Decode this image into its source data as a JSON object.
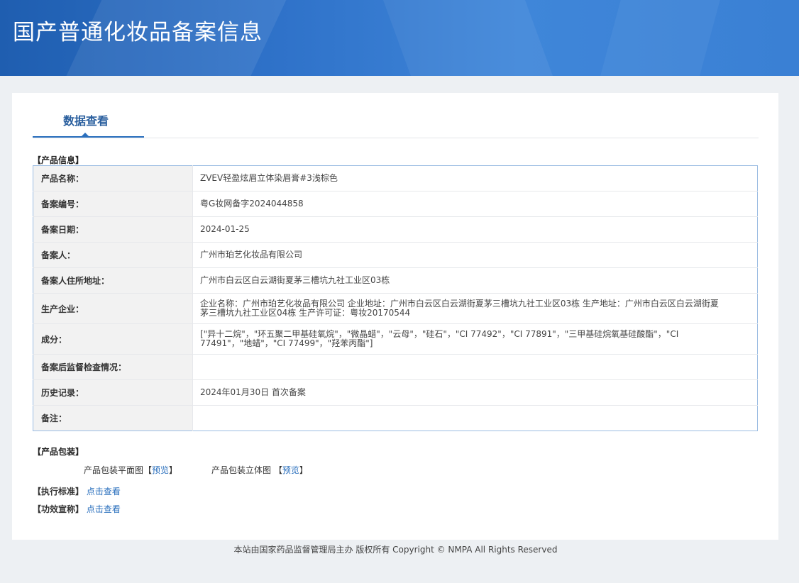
{
  "header": {
    "title": "国产普通化妆品备案信息"
  },
  "tabs": [
    {
      "label": "数据查看"
    }
  ],
  "product_info": {
    "section_title": "【产品信息】",
    "rows": [
      {
        "label": "产品名称：",
        "value": "ZVEV轻盈炫眉立体染眉膏#3浅棕色"
      },
      {
        "label": "备案编号：",
        "value": "粤G妆网备字2024044858"
      },
      {
        "label": "备案日期：",
        "value": "2024-01-25"
      },
      {
        "label": "备案人：",
        "value": "广州市珀艺化妆品有限公司"
      },
      {
        "label": "备案人住所地址：",
        "value": "广州市白云区白云湖街夏茅三槽坑九社工业区03栋"
      },
      {
        "label": "生产企业：",
        "value": "企业名称：广州市珀艺化妆品有限公司 企业地址：广州市白云区白云湖街夏茅三槽坑九社工业区03栋 生产地址：广州市白云区白云湖街夏茅三槽坑九社工业区04栋 生产许可证：粤妆20170544"
      },
      {
        "label": "成分：",
        "value": "[\"异十二烷\"，\"环五聚二甲基硅氧烷\"，\"微晶蜡\"，\"云母\"，\"硅石\"，\"CI 77492\"，\"CI 77891\"，\"三甲基硅烷氧基硅酸酯\"，\"CI 77491\"，\"地蜡\"，\"CI 77499\"，\"羟苯丙酯\"]"
      },
      {
        "label": "备案后监督检查情况：",
        "value": ""
      },
      {
        "label": "历史记录：",
        "value": "2024年01月30日 首次备案"
      },
      {
        "label": "备注：",
        "value": ""
      }
    ]
  },
  "packaging": {
    "section_title": "【产品包装】",
    "flat_label": "产品包装平面图",
    "solid_label": "产品包装立体图",
    "bracket_open": "【",
    "bracket_close": "】",
    "preview_link": "预览"
  },
  "standard": {
    "label": "【执行标准】",
    "link": "点击查看"
  },
  "efficacy": {
    "label": "【功效宣称】",
    "link": "点击查看"
  },
  "footer": {
    "text": "本站由国家药品监督管理局主办 版权所有 Copyright © NMPA All Rights Reserved"
  }
}
